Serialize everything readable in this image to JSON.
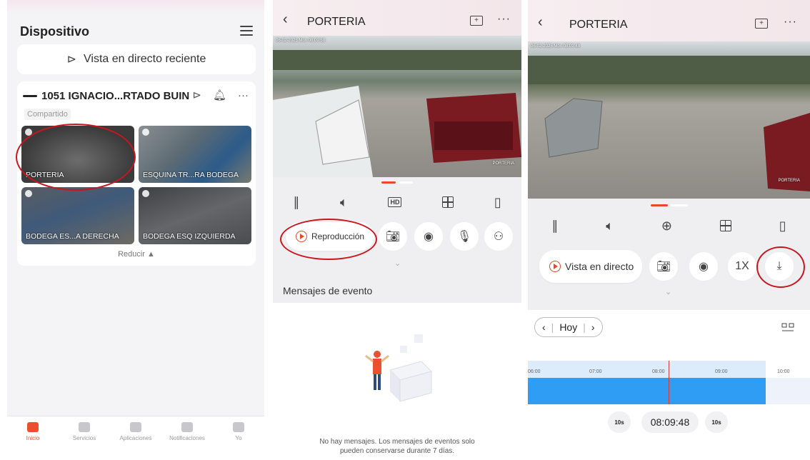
{
  "panel1": {
    "title": "Dispositivo",
    "recent_label": "Vista en directo reciente",
    "device_name": "1051 IGNACIO...RTADO BUIN",
    "shared_label": "Compartido",
    "cameras": [
      {
        "label": "PORTERIA"
      },
      {
        "label": "ESQUINA TR...RA BODEGA"
      },
      {
        "label": "BODEGA ES...A DERECHA"
      },
      {
        "label": "BODEGA ESQ IZQUIERDA"
      }
    ],
    "reduce_label": "Reducir ▲",
    "nav": [
      {
        "label": "Inicio",
        "icon": "home-icon"
      },
      {
        "label": "Servicios",
        "icon": "heart-icon"
      },
      {
        "label": "Aplicaciones",
        "icon": "apps-icon"
      },
      {
        "label": "Notificaciones",
        "icon": "bell-icon"
      },
      {
        "label": "Yo",
        "icon": "person-icon"
      }
    ],
    "accent": "#e8502e"
  },
  "panel2": {
    "title": "PORTERIA",
    "video_timestamp": "06-02-2025 Mon 08:09:58",
    "video_name": "PORTERIA",
    "playback_label": "Reproducción",
    "events_title": "Mensajes de evento",
    "empty_line1": "No hay mensajes. Los mensajes de eventos solo",
    "empty_line2": "pueden conservarse durante 7 días."
  },
  "panel3": {
    "title": "PORTERIA",
    "video_timestamp": "06-02-2025 Mon 08:09:48",
    "video_name": "PORTERIA",
    "live_label": "Vista en directo",
    "speed_label": "1X",
    "day_label": "Hoy",
    "timeline_labels": [
      "06:00",
      "07:00",
      "08:00",
      "09:00",
      "10:00"
    ],
    "current_time": "08:09:48",
    "skip_back_label": "10s",
    "skip_fwd_label": "10s"
  },
  "colors": {
    "highlight_oval": "#c9161e",
    "timeline_fill": "#2f9df4",
    "accent_orange": "#e54b2a"
  }
}
